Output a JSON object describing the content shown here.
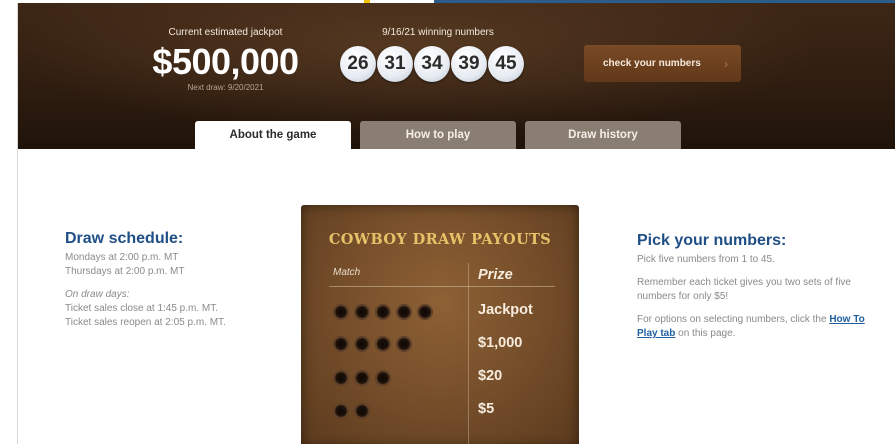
{
  "hero": {
    "jackpot_label": "Current estimated jackpot",
    "jackpot_amount": "$500,000",
    "next_draw": "Next draw: 9/20/2021",
    "winning_label": "9/16/21 winning numbers",
    "winning_numbers": [
      "26",
      "31",
      "34",
      "39",
      "45"
    ],
    "check_button": "check your numbers"
  },
  "tabs": [
    {
      "label": "About the game",
      "active": true
    },
    {
      "label": "How to play",
      "active": false
    },
    {
      "label": "Draw history",
      "active": false
    }
  ],
  "schedule": {
    "heading": "Draw schedule:",
    "line1": "Mondays at 2:00 p.m. MT",
    "line2": "Thursdays at 2:00 p.m. MT",
    "subheading": "On draw days:",
    "line3": "Ticket sales close at 1:45 p.m. MT.",
    "line4": "Ticket sales reopen at 2:05 p.m. MT."
  },
  "payouts": {
    "title": "COWBOY DRAW PAYOUTS",
    "col_match": "Match",
    "col_prize": "Prize",
    "rows": [
      {
        "matches": 5,
        "prize": "Jackpot"
      },
      {
        "matches": 4,
        "prize": "$1,000"
      },
      {
        "matches": 3,
        "prize": "$20"
      },
      {
        "matches": 2,
        "prize": "$5"
      }
    ]
  },
  "pick": {
    "heading": "Pick your numbers:",
    "p1": "Pick five numbers from 1 to 45.",
    "p2": "Remember each ticket gives you two sets of five numbers for only $5!",
    "p3_pre": "For options on selecting numbers, click the ",
    "p3_link": "How To Play tab",
    "p3_post": " on this page."
  },
  "colors": {
    "hero_bg": "#2f1d10",
    "heading_blue": "#1f4f86",
    "link_blue": "#1f5f9e",
    "board_title_gold": "#e7c168",
    "check_button_bg": "#6b3f1e"
  }
}
